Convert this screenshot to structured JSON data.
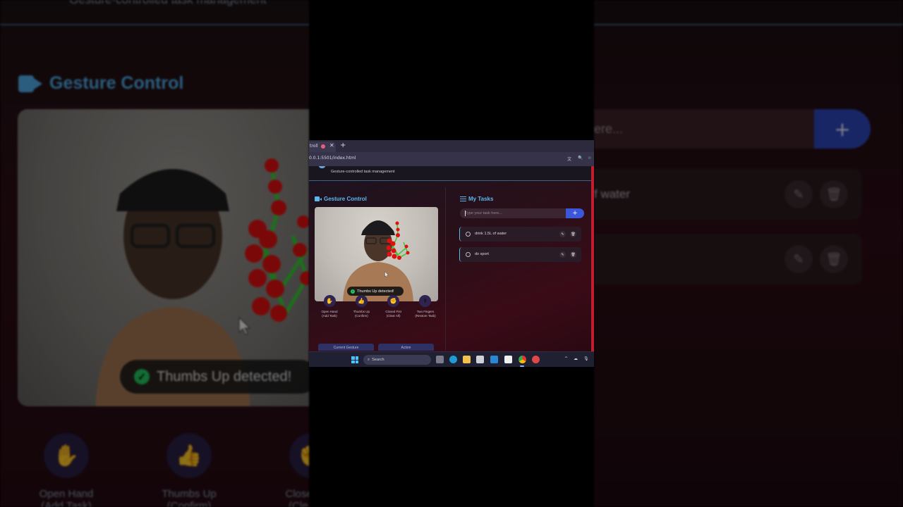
{
  "background": {
    "subtitle": "Gesture-controlled task management",
    "section_title": "Gesture Control",
    "toast": "Thumbs Up detected!",
    "gestures": [
      {
        "name": "Open Hand",
        "action": "(Add Task)",
        "emoji": "✋"
      },
      {
        "name": "Thumbs Up",
        "action": "(Confirm)",
        "emoji": "👍"
      },
      {
        "name": "Closed Fist",
        "action": "(Clear All)",
        "emoji": "✊"
      }
    ],
    "input_placeholder": "ere...",
    "add_label": "+",
    "task_1": "f water",
    "edit_icon": "✎",
    "delete_icon": "🗑"
  },
  "browser": {
    "tab_title": "troll",
    "close_icon": "✕",
    "new_tab_icon": "+",
    "url": "0.0.1:5501/index.html",
    "translate_icon": "文",
    "zoom_icon": "🔍",
    "star_icon": "☆"
  },
  "app": {
    "subtitle": "Gesture-controlled task management",
    "gesture_title": "Gesture Control",
    "toast": "Thumbs Up detected!",
    "check_icon": "✓",
    "gestures": [
      {
        "name": "Open Hand",
        "action": "(Add Task)",
        "emoji": "✋"
      },
      {
        "name": "Thumbs Up",
        "action": "(Confirm)",
        "emoji": "👍"
      },
      {
        "name": "Closed Fist",
        "action": "(Clear All)",
        "emoji": "✊"
      },
      {
        "name": "Two Fingers",
        "action": "(Restore Task)",
        "emoji": "✌"
      }
    ],
    "current_gesture_label": "Current Gesture",
    "action_label": "Action",
    "tasks_title": "My Tasks",
    "input_placeholder": "Type your task here...",
    "add_label": "+",
    "edit_icon": "✎",
    "delete_icon": "🗑",
    "tasks": [
      {
        "text": "drink 1.5L of water"
      },
      {
        "text": "do sport"
      }
    ]
  },
  "taskbar": {
    "search_label": "Search",
    "search_icon": "⌕",
    "tray_chevron": "^",
    "tray_cloud": "☁",
    "tray_mic": "🎙"
  },
  "colors": {
    "accent_blue": "#5db6ee",
    "add_button": "#3b56d8",
    "success": "#22c55e",
    "page_bg": "#2a0f18"
  }
}
